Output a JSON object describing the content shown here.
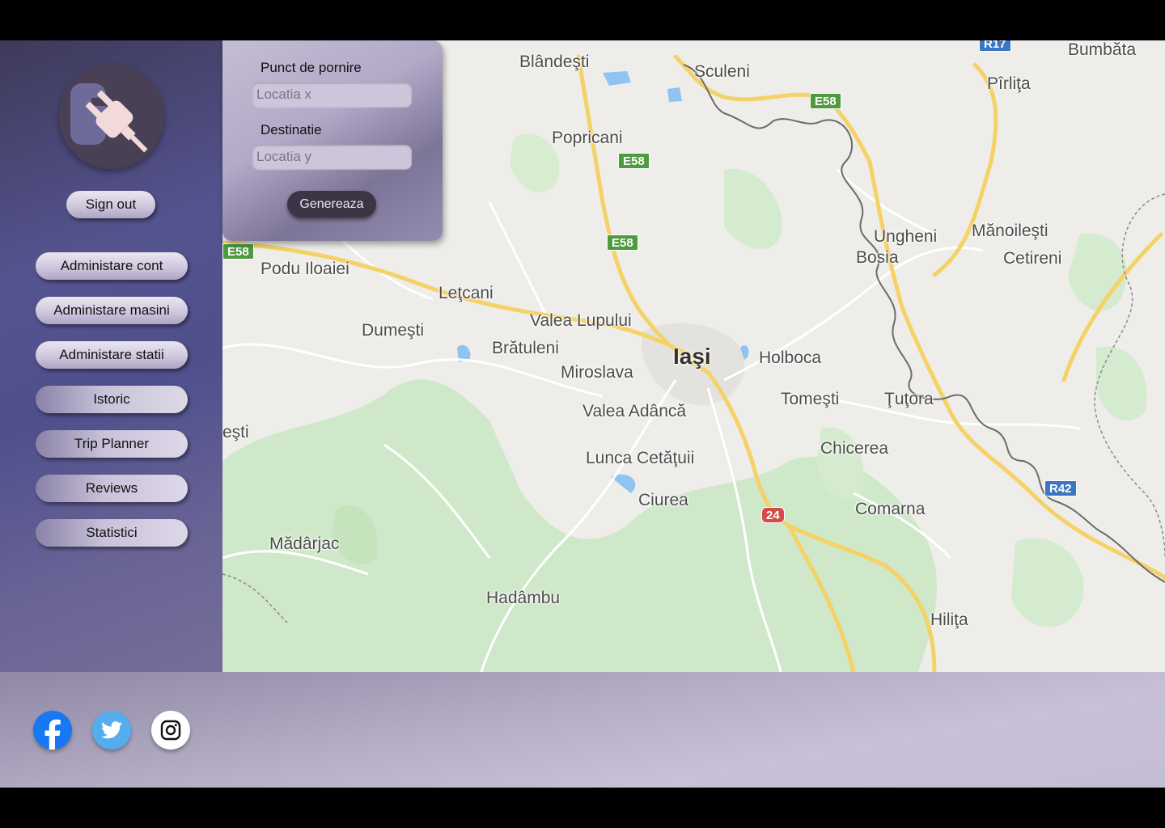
{
  "sidebar": {
    "sign_out": "Sign out",
    "menu": [
      "Administare cont",
      "Administare masini",
      "Administare statii",
      "Istoric",
      "Trip Planner",
      "Reviews",
      "Statistici"
    ]
  },
  "trip": {
    "start_label": "Punct de pornire",
    "start_placeholder": "Locatia x",
    "dest_label": "Destinatie",
    "dest_placeholder": "Locatia y",
    "generate": "Genereaza"
  },
  "map": {
    "places": {
      "blandesti": "Blândeşti",
      "sculeni": "Sculeni",
      "bumbata": "Bumbăta",
      "pirlita": "Pîrliţa",
      "popricani": "Popricani",
      "ungheni": "Ungheni",
      "bosia": "Bosia",
      "manoilesti": "Mănoileşti",
      "cetireni": "Cetireni",
      "podu_iloaiei": "Podu Iloaiei",
      "letcani": "Leţcani",
      "valea_lupului": "Valea Lupului",
      "dumesti": "Dumeşti",
      "bratuleni": "Brătuleni",
      "iasi": "Iaşi",
      "holboca": "Holboca",
      "miroslava": "Miroslava",
      "tomesti": "Tomeşti",
      "tutora": "Ţuţora",
      "valea_adanca": "Valea Adâncă",
      "esti": "eşti",
      "chicerea": "Chicerea",
      "lunca_cetatuii": "Lunca Cetăţuii",
      "ciurea": "Ciurea",
      "comarna": "Comarna",
      "madarjac": "Mădârjac",
      "hadambu": "Hadâmbu",
      "hilita": "Hiliţa"
    },
    "shields": {
      "e58": "E58",
      "r42": "R42",
      "r17": "R17",
      "n24": "24"
    }
  },
  "colors": {
    "facebook": "#1877f2",
    "twitter": "#55acee",
    "instagram": "#ffffff"
  },
  "icons": {
    "logo": "plug-icon",
    "facebook": "facebook-icon",
    "twitter": "twitter-icon",
    "instagram": "instagram-icon"
  }
}
